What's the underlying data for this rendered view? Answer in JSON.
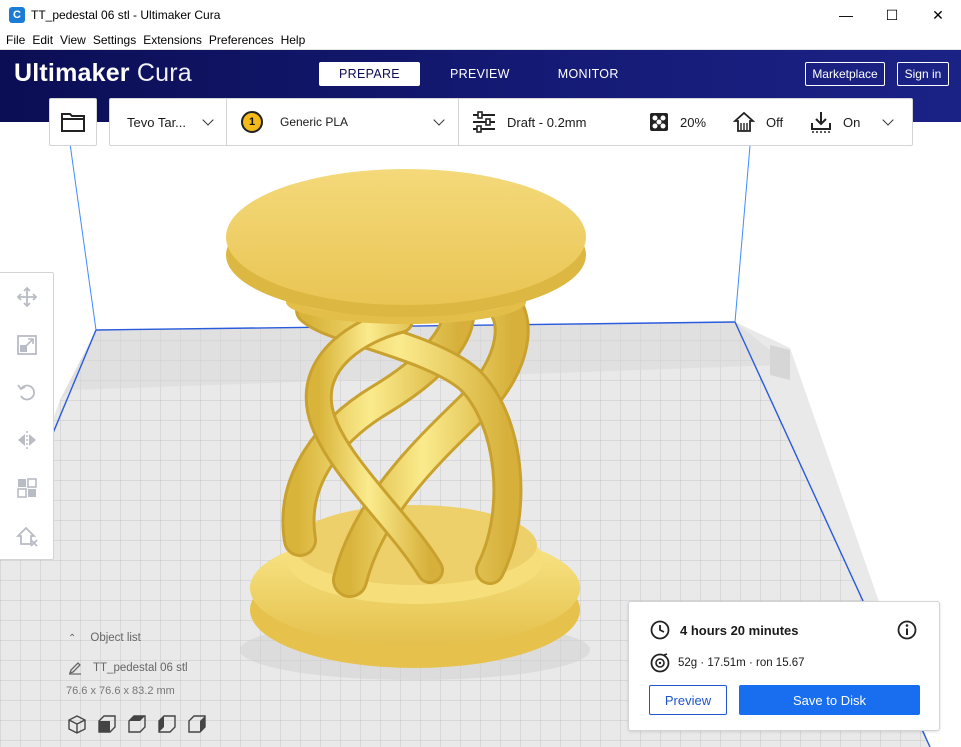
{
  "window": {
    "title": "TT_pedestal 06 stl - Ultimaker Cura",
    "app_icon_glyph": "C",
    "controls": {
      "minimize": "—",
      "maximize": "☐",
      "close": "✕"
    }
  },
  "menu": [
    "File",
    "Edit",
    "View",
    "Settings",
    "Extensions",
    "Preferences",
    "Help"
  ],
  "header": {
    "logo_light": "Ultimaker",
    "logo_bold": "Cura",
    "tabs": [
      {
        "label": "PREPARE",
        "active": true
      },
      {
        "label": "PREVIEW",
        "active": false
      },
      {
        "label": "MONITOR",
        "active": false
      }
    ],
    "marketplace_label": "Marketplace",
    "signin_label": "Sign in",
    "colors": {
      "header_start": "#0b0e54",
      "header_end": "#1b2286"
    }
  },
  "config": {
    "printer": "Tevo Tar...",
    "extruder_number": "1",
    "material": "Generic PLA",
    "profile": "Draft - 0.2mm",
    "infill": "20%",
    "support": "Off",
    "adhesion": "On"
  },
  "tools": [
    "move-icon",
    "scale-icon",
    "rotate-icon",
    "mirror-icon",
    "per-model-settings-icon",
    "support-blocker-icon"
  ],
  "object_list": {
    "header": "Object list",
    "object_name": "TT_pedestal 06 stl",
    "dimensions": "76.6 x 76.6 x 83.2 mm",
    "view_icons": [
      "3d-view-icon",
      "front-view-icon",
      "top-view-icon",
      "left-view-icon",
      "right-view-icon"
    ]
  },
  "print_panel": {
    "time": "4 hours 20 minutes",
    "material_usage": "52g · 17.51m · ron 15.67",
    "preview_label": "Preview",
    "save_label": "Save to Disk",
    "colors": {
      "accent": "#196ef0"
    }
  },
  "model": {
    "color": "#f5e06e"
  }
}
